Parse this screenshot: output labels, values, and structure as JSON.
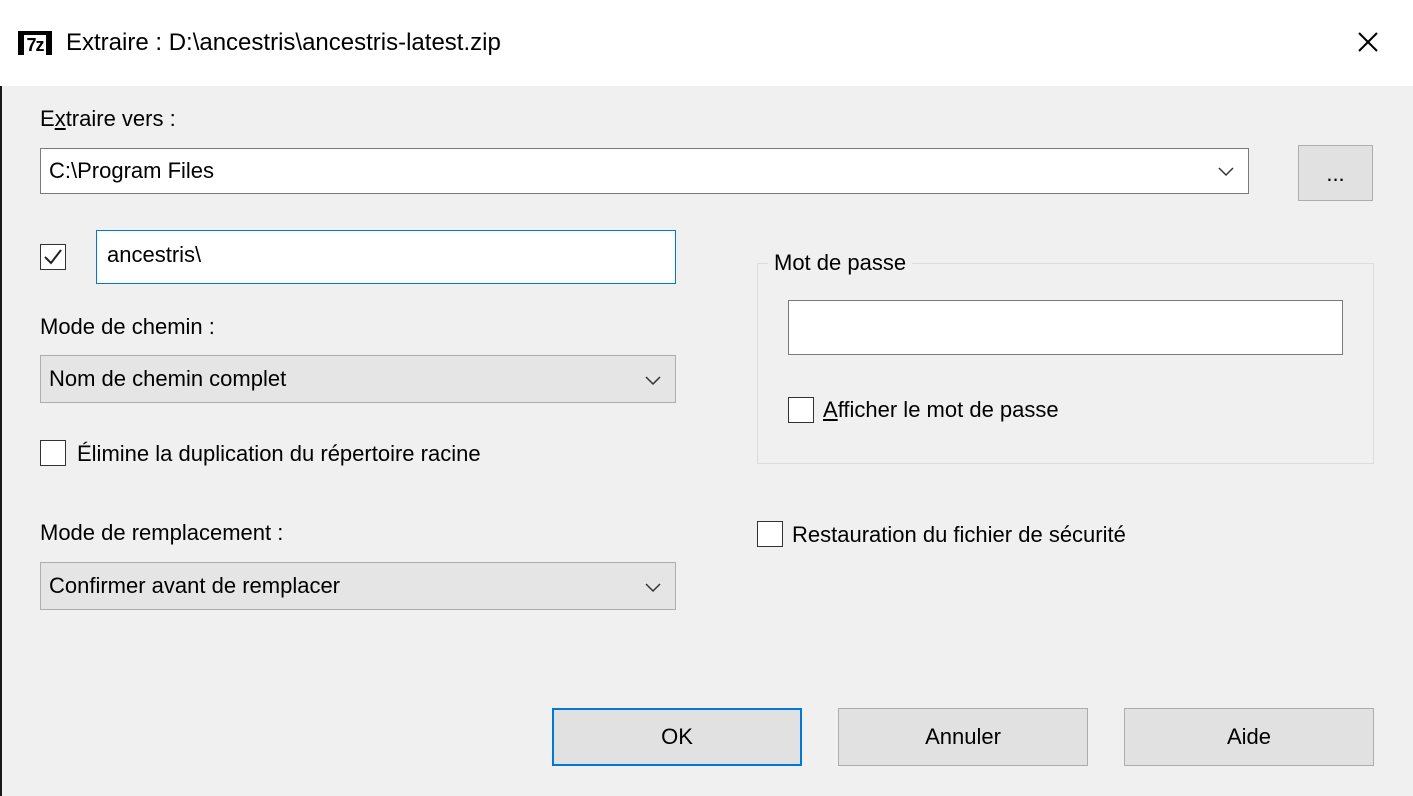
{
  "window": {
    "title": "Extraire : D:\\ancestris\\ancestris-latest.zip",
    "app_icon_text": "7z",
    "close_icon": "close-icon"
  },
  "extract_to": {
    "label_pre": "E",
    "label_accel": "x",
    "label_post": "traire vers :",
    "path_value": "C:\\Program Files",
    "browse_label": "..."
  },
  "subfolder": {
    "checked": true,
    "value": "ancestris\\"
  },
  "path_mode": {
    "label": "Mode de chemin :",
    "selected": "Nom de chemin complet"
  },
  "eliminate_duplication": {
    "checked": false,
    "label": "Élimine la duplication du répertoire racine"
  },
  "overwrite_mode": {
    "label": "Mode de remplacement :",
    "selected": "Confirmer avant de remplacer"
  },
  "password": {
    "group_label": "Mot de passe",
    "value": "",
    "show_checked": false,
    "show_label_accel": "A",
    "show_label_post": "fficher le mot de passe"
  },
  "restore_security": {
    "checked": false,
    "label": "Restauration du fichier de sécurité"
  },
  "buttons": {
    "ok": "OK",
    "cancel": "Annuler",
    "help": "Aide"
  },
  "colors": {
    "focus_accent": "#0078d7",
    "dialog_bg": "#f0f0f0"
  }
}
